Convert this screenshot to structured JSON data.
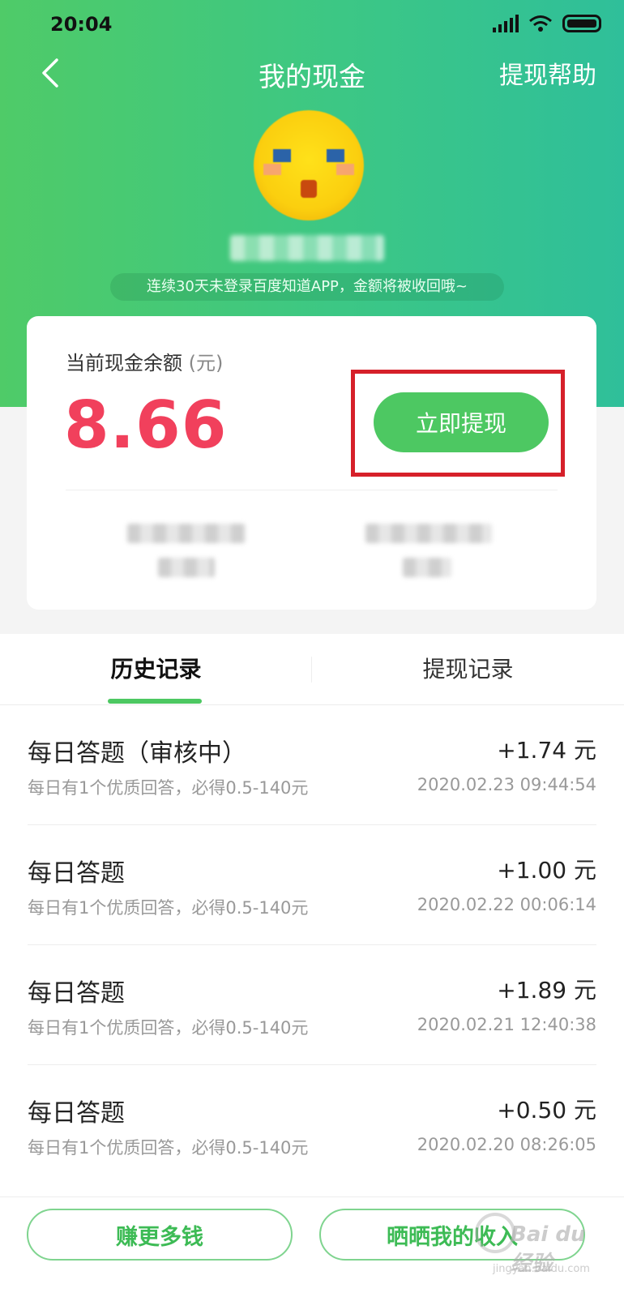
{
  "status_bar": {
    "time": "20:04",
    "icons": [
      "signal-icon",
      "wifi-icon",
      "battery-icon"
    ]
  },
  "nav": {
    "title": "我的现金",
    "help_label": "提现帮助",
    "back_icon": "chevron-left-icon"
  },
  "profile": {
    "notice": "连续30天未登录百度知道APP，金额将被收回哦~"
  },
  "balance": {
    "label": "当前现金余额",
    "unit_label": "(元)",
    "amount": "8.66",
    "withdraw_label": "立即提现"
  },
  "tabs": [
    {
      "label": "历史记录",
      "active": true
    },
    {
      "label": "提现记录",
      "active": false
    }
  ],
  "history": [
    {
      "title": "每日答题（审核中）",
      "amount": "+1.74 元",
      "desc": "每日有1个优质回答，必得0.5-140元",
      "time": "2020.02.23 09:44:54"
    },
    {
      "title": "每日答题",
      "amount": "+1.00 元",
      "desc": "每日有1个优质回答，必得0.5-140元",
      "time": "2020.02.22 00:06:14"
    },
    {
      "title": "每日答题",
      "amount": "+1.89 元",
      "desc": "每日有1个优质回答，必得0.5-140元",
      "time": "2020.02.21 12:40:38"
    },
    {
      "title": "每日答题",
      "amount": "+0.50 元",
      "desc": "每日有1个优质回答，必得0.5-140元",
      "time": "2020.02.20 08:26:05"
    }
  ],
  "bottom": {
    "earn_more_label": "赚更多钱",
    "share_income_label": "晒晒我的收入"
  },
  "watermark": {
    "main": "Bai du 经验",
    "sub": "jingyan.baidu.com"
  },
  "colors": {
    "header_gradient_start": "#4fcb68",
    "header_gradient_end": "#2fbf9a",
    "accent_green": "#4dc862",
    "balance_red": "#f1405c",
    "highlight_red": "#d6202a"
  }
}
